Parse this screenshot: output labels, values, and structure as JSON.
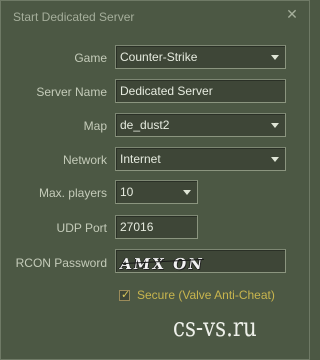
{
  "window": {
    "title": "Start Dedicated Server",
    "close_glyph": "✕"
  },
  "form": {
    "game": {
      "label": "Game",
      "value": "Counter-Strike"
    },
    "server_name": {
      "label": "Server Name",
      "value": "Dedicated Server"
    },
    "map": {
      "label": "Map",
      "value": "de_dust2"
    },
    "network": {
      "label": "Network",
      "value": "Internet"
    },
    "max_players": {
      "label": "Max. players",
      "value": "10"
    },
    "udp_port": {
      "label": "UDP Port",
      "value": "27016"
    },
    "rcon_password": {
      "label": "RCON Password",
      "value": "AMX ON"
    },
    "secure": {
      "label": "Secure (Valve Anti-Cheat)",
      "checked": true,
      "check_glyph": "✓"
    }
  },
  "watermark": {
    "text": "cs-vs.ru"
  },
  "colors": {
    "background": "#4c5844",
    "field_bg": "#3e4637",
    "label_text": "#c4cbb9",
    "field_text": "#e6ebdf",
    "secure_text": "#c8b54e"
  }
}
